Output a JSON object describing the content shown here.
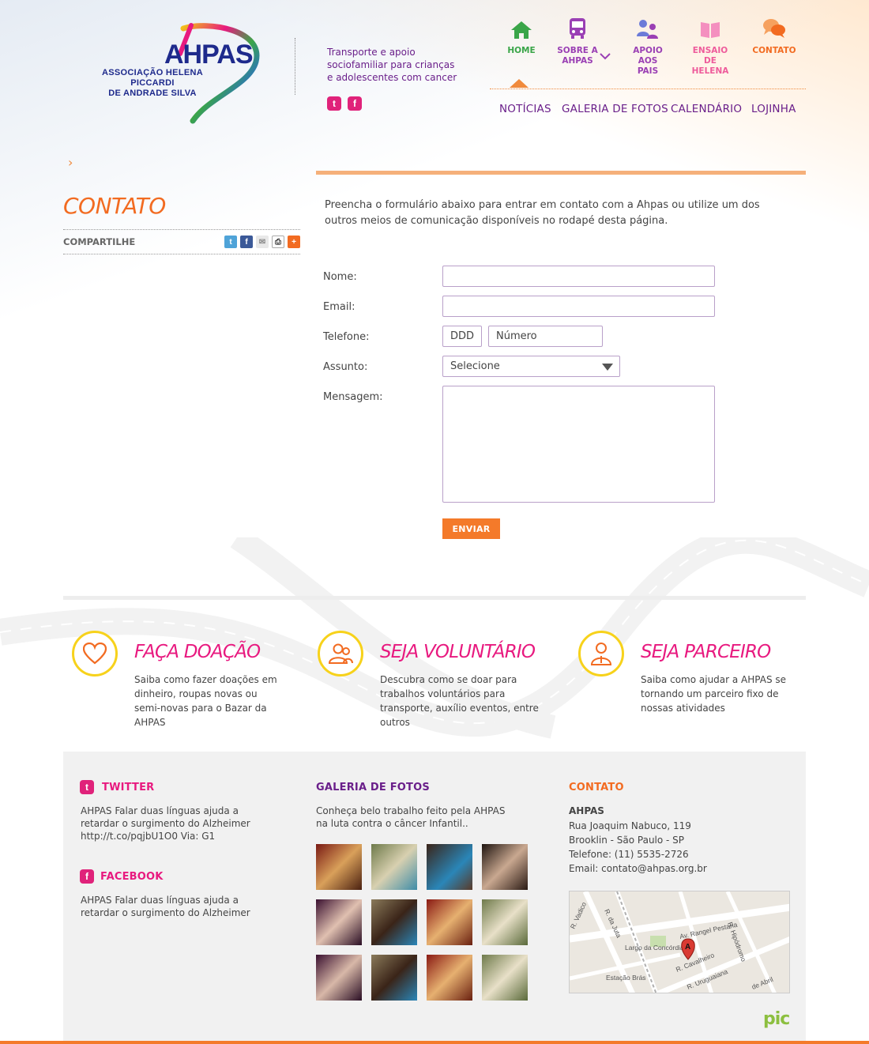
{
  "header": {
    "logo_word": "AHPAS",
    "logo_org_line1": "ASSOCIAÇÃO HELENA PICCARDI",
    "logo_org_line2": "DE ANDRADE SILVA",
    "tagline": "Transporte e apoio sociofamiliar para crianças e adolescentes com cancer",
    "social": [
      {
        "icon": "twitter-icon",
        "glyph": "t",
        "color": "#e0227a"
      },
      {
        "icon": "facebook-icon",
        "glyph": "f",
        "color": "#e0227a"
      }
    ]
  },
  "nav": {
    "items": [
      {
        "label": "HOME",
        "icon": "home-icon",
        "color": "#3aa548"
      },
      {
        "label": "SOBRE A AHPAS",
        "icon": "bus-icon",
        "color": "#9a3fb4"
      },
      {
        "label": "APOIO AOS PAIS",
        "icon": "parents-icon",
        "color": "#9a3fb4"
      },
      {
        "label": "ENSAIO DE HELENA",
        "icon": "book-icon",
        "color": "#ee5b9b"
      },
      {
        "label": "CONTATO",
        "icon": "chat-icon",
        "color": "#f26b21"
      }
    ],
    "subnav": [
      "NOTÍCIAS",
      "GALERIA DE FOTOS",
      "CALENDÁRIO",
      "LOJINHA"
    ]
  },
  "page": {
    "title": "CONTATO",
    "share_label": "COMPARTILHE",
    "intro": "Preencha o formulário abaixo para entrar em contato com a Ahpas ou utilize um dos outros meios de comunicação disponíveis no rodapé desta página."
  },
  "form": {
    "name_label": "Nome:",
    "email_label": "Email:",
    "phone_label": "Telefone:",
    "ddd_placeholder": "DDD",
    "number_placeholder": "Número",
    "subject_label": "Assunto:",
    "subject_value": "Selecione",
    "message_label": "Mensagem:",
    "submit_label": "ENVIAR"
  },
  "promos": [
    {
      "title": "FAÇA DOAÇÃO",
      "desc": "Saiba como fazer doações em dinheiro, roupas novas ou semi-novas para o Bazar da AHPAS",
      "icon": "heart-icon"
    },
    {
      "title": "SEJA VOLUNTÁRIO",
      "desc": "Descubra como se doar para trabalhos voluntários para transporte, auxílio eventos, entre outros",
      "icon": "volunteers-icon"
    },
    {
      "title": "SEJA PARCEIRO",
      "desc": "Saiba como ajudar a AHPAS se tornando um parceiro fixo de nossas atividades",
      "icon": "partner-icon"
    }
  ],
  "footer": {
    "twitter_title": "TWITTER",
    "twitter_text": "AHPAS Falar duas línguas ajuda a retardar o surgimento do Alzheimer http://t.co/pqjbU1O0 Via: G1",
    "facebook_title": "FACEBOOK",
    "facebook_text": "AHPAS Falar duas línguas ajuda a retardar o surgimento do Alzheimer",
    "gallery_title": "GALERIA DE FOTOS",
    "gallery_text": "Conheça belo trabalho feito pela AHPAS na luta contra o câncer Infantil..",
    "contact_title": "CONTATO",
    "contact_name": "AHPAS",
    "contact_address": "Rua Joaquim Nabuco, 119",
    "contact_city": "Brooklin - São Paulo - SP",
    "contact_phone": "Telefone: (11) 5535-2726",
    "contact_email": "Email: contato@ahpas.org.br",
    "map_labels": [
      "R. Vadico",
      "R. da Juta",
      "Av. Rangel Pestana",
      "R. Hipódromo",
      "Largo da Concórdia",
      "R. Cavalheiro",
      "R. Uruguaiana",
      "Estação Brás",
      "de Abril"
    ],
    "map_marker": "A",
    "credit": "pic"
  },
  "colors": {
    "orange": "#f26b21",
    "purple": "#6a1f8a",
    "magenta": "#e8197f",
    "green": "#3aa548",
    "yellow": "#f7d21b"
  }
}
